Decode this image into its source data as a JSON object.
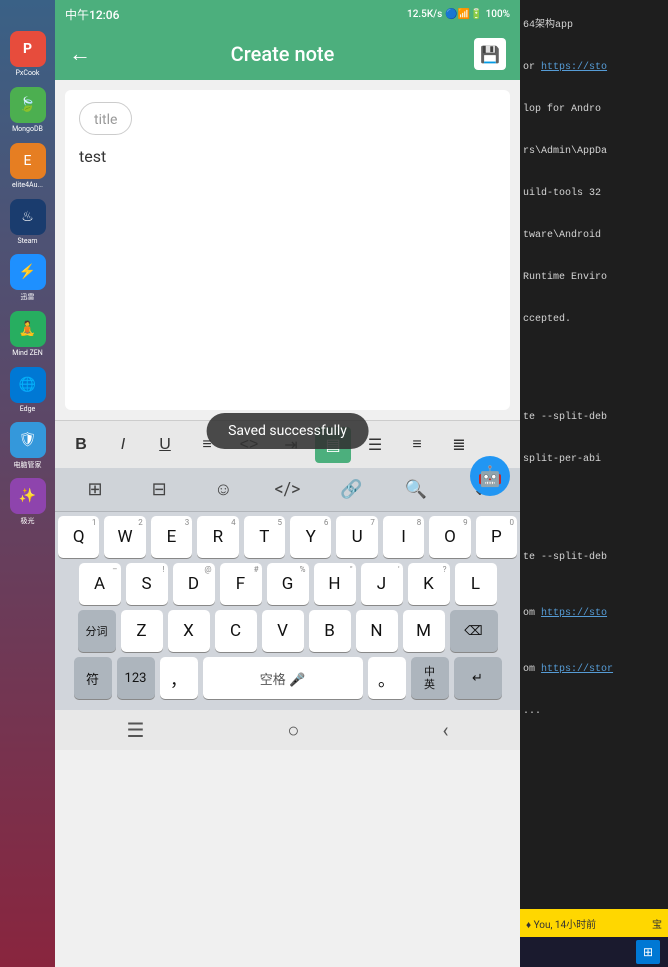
{
  "statusBar": {
    "time": "中午12:06",
    "network": "12.5K/s",
    "battery": "100%"
  },
  "appBar": {
    "title": "Create note",
    "backIcon": "←",
    "saveIcon": "💾"
  },
  "note": {
    "titlePlaceholder": "title",
    "content": "test"
  },
  "toast": {
    "message": "Saved successfully"
  },
  "toolbar": {
    "bold": "B",
    "italic": "I",
    "underline": "U",
    "list": "≡",
    "code": "<>",
    "indent": "⇥",
    "alignRight": "▤",
    "alignCenter": "☰",
    "alignLeft": "≡",
    "alignJustify": "≣"
  },
  "keyboard": {
    "topTools": [
      "⊞",
      "⊟",
      "☺",
      "</>",
      "⚓",
      "🔍",
      "⌄"
    ],
    "row1": [
      {
        "label": "Q",
        "num": "1"
      },
      {
        "label": "W",
        "num": "2"
      },
      {
        "label": "E",
        "num": "3"
      },
      {
        "label": "R",
        "num": "4"
      },
      {
        "label": "T",
        "num": "5"
      },
      {
        "label": "Y",
        "num": "6"
      },
      {
        "label": "U",
        "num": "7"
      },
      {
        "label": "I",
        "num": "8"
      },
      {
        "label": "O",
        "num": "9"
      },
      {
        "label": "P",
        "num": "0"
      }
    ],
    "row2": [
      {
        "label": "A",
        "num": "–"
      },
      {
        "label": "S",
        "num": "!"
      },
      {
        "label": "D",
        "num": "@"
      },
      {
        "label": "F",
        "num": "#"
      },
      {
        "label": "G",
        "num": "%"
      },
      {
        "label": "H",
        "num": "\""
      },
      {
        "label": "J",
        "num": "'"
      },
      {
        "label": "K",
        "num": "?"
      },
      {
        "label": "L",
        "num": ""
      }
    ],
    "row3": [
      {
        "label": "Z"
      },
      {
        "label": "X"
      },
      {
        "label": "C"
      },
      {
        "label": "V"
      },
      {
        "label": "B"
      },
      {
        "label": "N"
      },
      {
        "label": "M"
      }
    ],
    "shiftKey": "分词",
    "backspaceKey": "⌫",
    "row4": [
      {
        "label": "符"
      },
      {
        "label": "123"
      },
      {
        "label": "，"
      },
      {
        "label": "空格 🎤",
        "isSpace": true
      },
      {
        "label": "。"
      },
      {
        "label": "中\n英"
      },
      {
        "label": "↵",
        "isEnter": true
      }
    ]
  },
  "bottomNav": {
    "menu": "☰",
    "home": "○",
    "back": "‹"
  },
  "terminal": {
    "lines": [
      "64架构app",
      "",
      "or https://sto",
      "",
      "lop for Andro",
      "rs\\Admin\\AppDa",
      "uild-tools 32",
      "tware\\Android",
      "Runtime Enviro",
      "ccepted.",
      "",
      "",
      "",
      "",
      "",
      "te --split-deb",
      "split-per-abi",
      "",
      "",
      "",
      "",
      "",
      "te --split-deb",
      "",
      "om https://sto",
      "",
      "om https://stor",
      "...",
      "",
      ""
    ]
  },
  "notification": {
    "text": "♦ You, 14小时前",
    "extra": "宝"
  },
  "desktopIcons": [
    {
      "label": "PxCook",
      "color": "#e74c3c"
    },
    {
      "label": "MongoDB",
      "color": "#4caf50"
    },
    {
      "label": "elite4Au...",
      "color": "#e67e22"
    },
    {
      "label": "Steam",
      "color": "#1a3c6e"
    },
    {
      "label": "迅雷",
      "color": "#1e90ff"
    },
    {
      "label": "Mind ZEN",
      "color": "#27ae60"
    },
    {
      "label": "Edge",
      "color": "#0078d4"
    },
    {
      "label": "电脑管家",
      "color": "#3498db"
    },
    {
      "label": "极光",
      "color": "#8e44ad"
    }
  ]
}
